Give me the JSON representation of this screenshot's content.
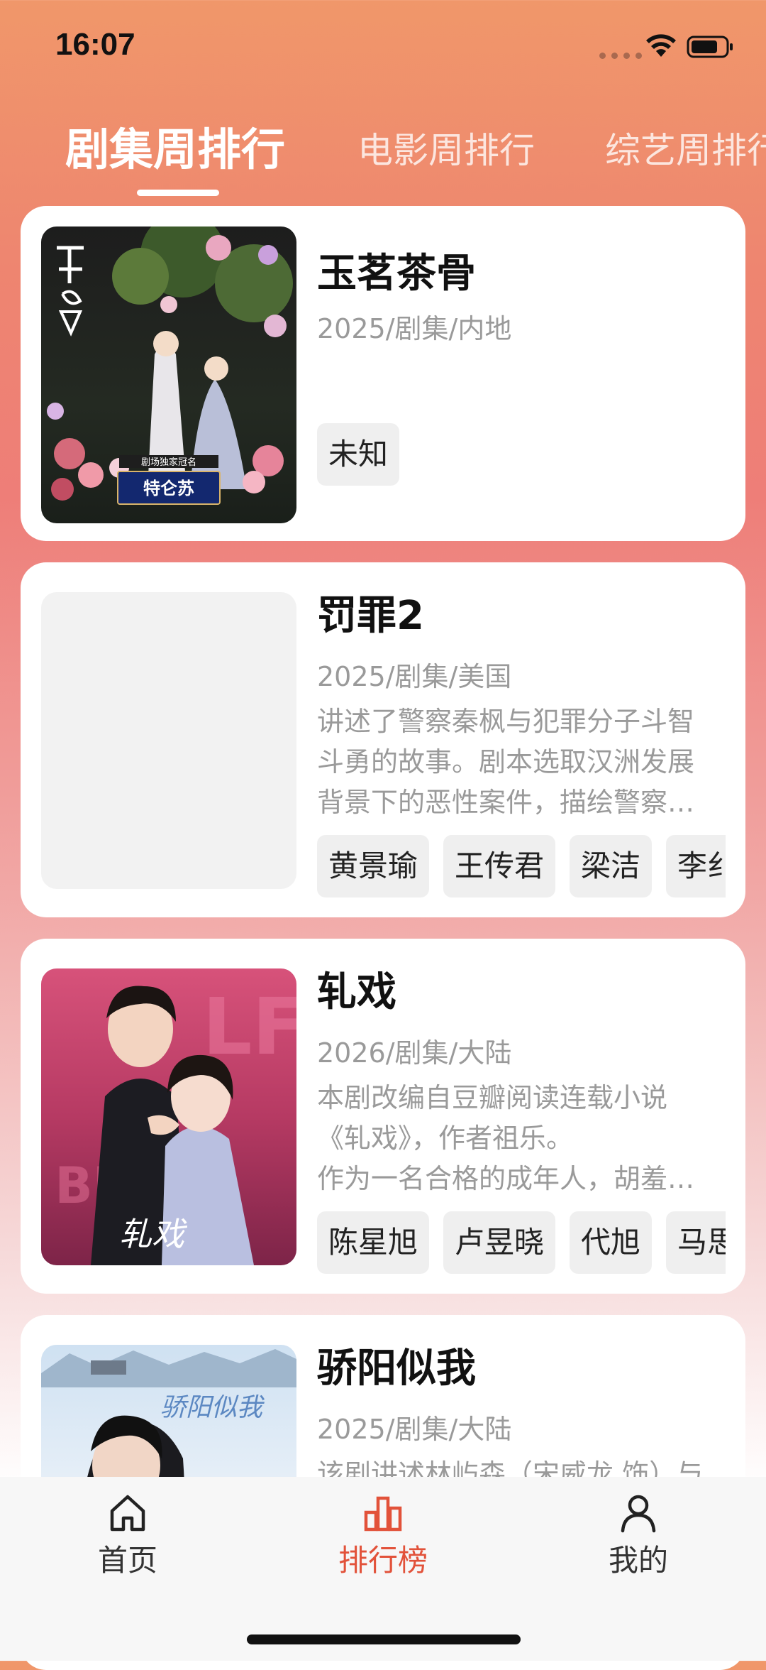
{
  "status_bar": {
    "time": "16:07"
  },
  "tabs": [
    {
      "label": "剧集周排行",
      "active": true
    },
    {
      "label": "电影周排行",
      "active": false
    },
    {
      "label": "综艺周排行",
      "active": false
    }
  ],
  "rankings": [
    {
      "title": "玉茗茶骨",
      "meta": "2025/剧集/内地",
      "description": [],
      "cast": [
        "未知"
      ],
      "poster_text": [
        "剧场独家冠名",
        "特仑苏"
      ]
    },
    {
      "title": "罚罪2",
      "meta": "2025/剧集/美国",
      "description": [
        "讲述了警察秦枫与犯罪分子斗智",
        "斗勇的故事。剧本选取汉洲发展",
        "背景下的恶性案件，描绘警察…"
      ],
      "cast": [
        "黄景瑜",
        "王传君",
        "梁洁",
        "李纟"
      ]
    },
    {
      "title": "轧戏",
      "meta": "2026/剧集/大陆",
      "description": [
        "本剧改编自豆瓣阅读连载小说",
        "《轧戏》，作者祖乐。",
        "作为一名合格的成年人，胡羞…"
      ],
      "cast": [
        "陈星旭",
        "卢昱晓",
        "代旭",
        "马思"
      ],
      "poster_text": [
        "轧戏"
      ]
    },
    {
      "title": "骄阳似我",
      "meta": "2025/剧集/大陆",
      "description": [
        "该剧讲述林屿森（宋威龙 饰）与"
      ],
      "poster_text": [
        "骄阳似我"
      ]
    }
  ],
  "bottom_nav": [
    {
      "label": "首页",
      "icon": "home-icon",
      "active": false
    },
    {
      "label": "排行榜",
      "icon": "chart-icon",
      "active": true
    },
    {
      "label": "我的",
      "icon": "person-icon",
      "active": false
    }
  ],
  "colors": {
    "accent": "#E2523A",
    "gradient_top": "#F0976A",
    "gradient_mid": "#EE7E78",
    "chip_bg": "#EFEFEF"
  }
}
